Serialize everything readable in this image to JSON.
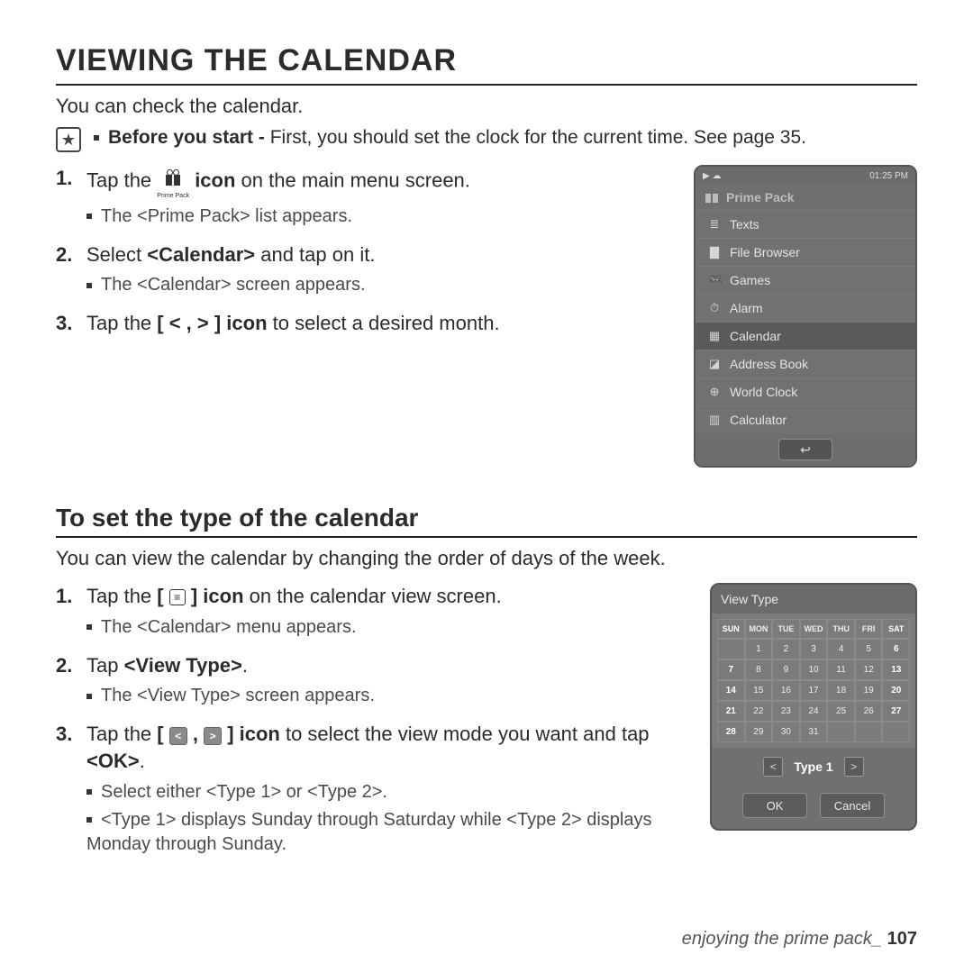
{
  "title": "VIEWING THE CALENDAR",
  "intro": "You can check the calendar.",
  "note": {
    "bold": "Before you start - ",
    "rest": "First, you should set the clock for the current time. See page 35."
  },
  "s1": {
    "i1a": "Tap the ",
    "i1b": " icon",
    "i1c": " on the main menu screen.",
    "i1s": "The <Prime Pack> list appears.",
    "i2a": "Select ",
    "i2b": "<Calendar>",
    "i2c": " and tap on it.",
    "i2s": "The <Calendar> screen appears.",
    "i3a": "Tap the ",
    "i3b": "[ < , > ] icon",
    "i3c": " to select a desired month."
  },
  "prime_caption": "Prime Pack",
  "phone1": {
    "time": "01:25 PM",
    "title": "Prime Pack",
    "items": [
      {
        "icon": "≣",
        "label": "Texts"
      },
      {
        "icon": "▇",
        "label": "File Browser"
      },
      {
        "icon": "🎮",
        "label": "Games"
      },
      {
        "icon": "⏱",
        "label": "Alarm"
      },
      {
        "icon": "▦",
        "label": "Calendar",
        "sel": true
      },
      {
        "icon": "◪",
        "label": "Address Book"
      },
      {
        "icon": "⊕",
        "label": "World Clock"
      },
      {
        "icon": "▥",
        "label": "Calculator"
      }
    ],
    "back": "↩"
  },
  "sectionTitle": "To set the type of the calendar",
  "sectionDesc": "You can view the calendar by changing the order of days of the week.",
  "s2": {
    "i1a": "Tap the ",
    "i1b": "[",
    "i1c": "] icon",
    "i1d": " on the calendar view screen.",
    "i1s": "The <Calendar> menu appears.",
    "i2a": "Tap ",
    "i2b": "<View Type>",
    "i2c": ".",
    "i2s": "The <View Type> screen appears.",
    "i3a": "Tap the ",
    "i3b": "[ ",
    "i3c": " , ",
    "i3d": " ] icon",
    "i3e": " to select the view mode you want and tap ",
    "i3f": "<OK>",
    "i3g": ".",
    "i3s1": "Select either <Type 1> or <Type 2>.",
    "i3s2": "<Type 1> displays Sunday through Saturday while <Type 2> displays Monday through Sunday."
  },
  "phone2": {
    "title": "View Type",
    "typeLabel": "Type 1",
    "ok": "OK",
    "cancel": "Cancel"
  },
  "chart_data": {
    "type": "table",
    "title": "View Type calendar grid",
    "columns": [
      "SUN",
      "MON",
      "TUE",
      "WED",
      "THU",
      "FRI",
      "SAT"
    ],
    "rows": [
      [
        "",
        "1",
        "2",
        "3",
        "4",
        "5",
        "6"
      ],
      [
        "7",
        "8",
        "9",
        "10",
        "11",
        "12",
        "13"
      ],
      [
        "14",
        "15",
        "16",
        "17",
        "18",
        "19",
        "20"
      ],
      [
        "21",
        "22",
        "23",
        "24",
        "25",
        "26",
        "27"
      ],
      [
        "28",
        "29",
        "30",
        "31",
        "",
        "",
        ""
      ]
    ]
  },
  "footer": {
    "text": "enjoying the prime pack_ ",
    "page": "107"
  }
}
